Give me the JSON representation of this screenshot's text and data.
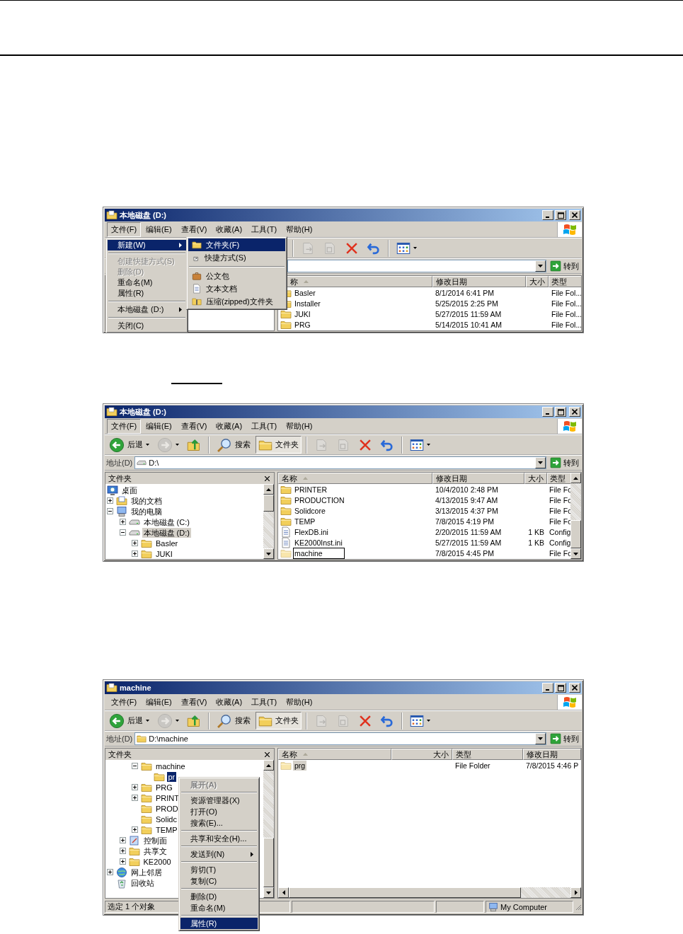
{
  "windows": [
    {
      "title": "本地磁盘 (D:)",
      "menu": [
        {
          "label": "文件(F)",
          "selected": true
        },
        {
          "label": "编辑(E)",
          "selected": false
        },
        {
          "label": "查看(V)",
          "selected": false
        },
        {
          "label": "收藏(A)",
          "selected": false
        },
        {
          "label": "工具(T)",
          "selected": false
        },
        {
          "label": "帮助(H)",
          "selected": false
        }
      ],
      "toolbar": [
        {
          "kind": "separator"
        },
        {
          "kind": "move",
          "disabled": true
        },
        {
          "kind": "copy",
          "disabled": true
        },
        {
          "kind": "delete",
          "disabled": false
        },
        {
          "kind": "undo",
          "disabled": false
        },
        {
          "kind": "separator"
        },
        {
          "kind": "views",
          "disabled": false
        }
      ],
      "address": {
        "go_label": "转到"
      },
      "file_list": {
        "columns": [
          {
            "kind": "name",
            "label": "称",
            "sorted": true
          },
          {
            "kind": "date",
            "label": "修改日期",
            "sorted": false
          },
          {
            "kind": "size",
            "label": "大小",
            "sorted": false
          },
          {
            "kind": "type",
            "label": "类型",
            "sorted": false
          }
        ],
        "rows": [
          {
            "kind": "folder",
            "name": "Basler",
            "date": "8/1/2014 6:41 PM",
            "type": "File Fol...",
            "selected": false,
            "editing": false
          },
          {
            "kind": "folder",
            "name": "Installer",
            "date": "5/25/2015 2:25 PM",
            "type": "File Fol...",
            "selected": false,
            "editing": false
          },
          {
            "kind": "folder",
            "name": "JUKI",
            "date": "5/27/2015 11:59 AM",
            "type": "File Fol...",
            "selected": false,
            "editing": false
          },
          {
            "kind": "folder",
            "name": "PRG",
            "date": "5/14/2015 10:41 AM",
            "type": "File Fol...",
            "selected": false,
            "editing": false
          }
        ]
      },
      "file_menu": [
        {
          "kind": "item",
          "label": "新建(W)",
          "selected": true,
          "disabled": false,
          "submenu": true
        },
        {
          "kind": "separator"
        },
        {
          "kind": "item",
          "label": "创建快捷方式(S)",
          "selected": false,
          "disabled": true,
          "submenu": false
        },
        {
          "kind": "item",
          "label": "删除(D)",
          "selected": false,
          "disabled": true,
          "submenu": false
        },
        {
          "kind": "item",
          "label": "重命名(M)",
          "selected": false,
          "disabled": false,
          "submenu": false
        },
        {
          "kind": "item",
          "label": "属性(R)",
          "selected": false,
          "disabled": false,
          "submenu": false
        },
        {
          "kind": "separator"
        },
        {
          "kind": "item",
          "label": "本地磁盘 (D:)",
          "selected": false,
          "disabled": false,
          "submenu": true
        },
        {
          "kind": "separator"
        },
        {
          "kind": "item",
          "label": "关闭(C)",
          "selected": false,
          "disabled": false,
          "submenu": false
        }
      ],
      "new_submenu": [
        {
          "kind": "folder",
          "label": "文件夹(F)",
          "selected": true
        },
        {
          "kind": "shortcut",
          "label": "快捷方式(S)",
          "selected": false
        },
        {
          "kind": "separator"
        },
        {
          "kind": "briefcase",
          "label": "公文包",
          "selected": false
        },
        {
          "kind": "textdoc",
          "label": "文本文档",
          "selected": false
        },
        {
          "kind": "zip",
          "label": "压缩(zipped)文件夹",
          "selected": false
        }
      ]
    },
    {
      "title": "本地磁盘 (D:)",
      "menu": [
        {
          "label": "文件(F)",
          "selected": true
        },
        {
          "label": "编辑(E)",
          "selected": false
        },
        {
          "label": "查看(V)",
          "selected": false
        },
        {
          "label": "收藏(A)",
          "selected": false
        },
        {
          "label": "工具(T)",
          "selected": false
        },
        {
          "label": "帮助(H)",
          "selected": false
        }
      ],
      "toolbar": [
        {
          "kind": "back",
          "label": "后退",
          "disabled": false
        },
        {
          "kind": "forward",
          "disabled": true
        },
        {
          "kind": "up",
          "disabled": false
        },
        {
          "kind": "separator"
        },
        {
          "kind": "search",
          "label": "搜索",
          "disabled": false,
          "pressed": false
        },
        {
          "kind": "folders",
          "label": "文件夹",
          "disabled": false,
          "pressed": true
        },
        {
          "kind": "separator"
        },
        {
          "kind": "move",
          "disabled": true
        },
        {
          "kind": "copy",
          "disabled": true
        },
        {
          "kind": "delete",
          "disabled": false
        },
        {
          "kind": "undo",
          "disabled": false
        },
        {
          "kind": "separator"
        },
        {
          "kind": "views",
          "disabled": false
        }
      ],
      "address": {
        "label": "地址(D)",
        "kind": "drive",
        "value": "D:\\",
        "go_label": "转到"
      },
      "folder_pane": {
        "title": "文件夹",
        "focused": false,
        "tree": [
          {
            "kind": "desktop",
            "label": "桌面",
            "selected": false,
            "children": [
              {
                "kind": "documents",
                "label": "我的文档",
                "expanded": false,
                "selected": false
              },
              {
                "kind": "computer",
                "label": "我的电脑",
                "expanded": true,
                "selected": false,
                "children": [
                  {
                    "kind": "drive",
                    "label": "本地磁盘 (C:)",
                    "expanded": false,
                    "selected": false
                  },
                  {
                    "kind": "drive",
                    "label": "本地磁盘 (D:)",
                    "expanded": true,
                    "selected": true,
                    "children": [
                      {
                        "kind": "folder",
                        "label": "Basler",
                        "expanded": false,
                        "selected": false
                      },
                      {
                        "kind": "folder",
                        "label": "JUKI",
                        "expanded": false,
                        "selected": false
                      }
                    ]
                  }
                ]
              }
            ]
          }
        ]
      },
      "file_list": {
        "columns": [
          {
            "kind": "name",
            "label": "名称",
            "sorted": true
          },
          {
            "kind": "date",
            "label": "修改日期",
            "sorted": false
          },
          {
            "kind": "size",
            "label": "大小",
            "sorted": false
          },
          {
            "kind": "type",
            "label": "类型",
            "sorted": false
          }
        ],
        "rows": [
          {
            "kind": "folder",
            "name": "PRINTER",
            "date": "10/4/2010 2:48 PM",
            "type": "File Fc",
            "selected": false,
            "editing": false
          },
          {
            "kind": "folder",
            "name": "PRODUCTION",
            "date": "4/13/2015 9:47 AM",
            "type": "File Fc",
            "selected": false,
            "editing": false
          },
          {
            "kind": "folder",
            "name": "Solidcore",
            "date": "3/13/2015 4:37 PM",
            "type": "File Fc",
            "selected": false,
            "editing": false
          },
          {
            "kind": "folder",
            "name": "TEMP",
            "date": "7/8/2015 4:19 PM",
            "type": "File Fc",
            "selected": false,
            "editing": false
          },
          {
            "kind": "ini",
            "name": "FlexDB.ini",
            "date": "2/20/2015 11:59 AM",
            "size": "1 KB",
            "type": "Config",
            "selected": false,
            "editing": false
          },
          {
            "kind": "ini",
            "name": "KE2000Inst.ini",
            "date": "5/27/2015 11:59 AM",
            "size": "1 KB",
            "type": "Config",
            "selected": false,
            "editing": false
          },
          {
            "kind": "folder",
            "name": "machine",
            "date": "7/8/2015 4:45 PM",
            "type": "File Fc",
            "selected": false,
            "editing": true
          }
        ]
      }
    },
    {
      "title": "machine",
      "menu": [
        {
          "label": "文件(F)",
          "selected": false
        },
        {
          "label": "编辑(E)",
          "selected": false
        },
        {
          "label": "查看(V)",
          "selected": false
        },
        {
          "label": "收藏(A)",
          "selected": false
        },
        {
          "label": "工具(T)",
          "selected": false
        },
        {
          "label": "帮助(H)",
          "selected": false
        }
      ],
      "toolbar": [
        {
          "kind": "back",
          "label": "后退",
          "disabled": false
        },
        {
          "kind": "forward",
          "disabled": true
        },
        {
          "kind": "up",
          "disabled": false
        },
        {
          "kind": "separator"
        },
        {
          "kind": "search",
          "label": "搜索",
          "disabled": false,
          "pressed": false
        },
        {
          "kind": "folders",
          "label": "文件夹",
          "disabled": false,
          "pressed": true
        },
        {
          "kind": "separator"
        },
        {
          "kind": "move",
          "disabled": true
        },
        {
          "kind": "copy",
          "disabled": true
        },
        {
          "kind": "delete",
          "disabled": false
        },
        {
          "kind": "undo",
          "disabled": false
        },
        {
          "kind": "separator"
        },
        {
          "kind": "views",
          "disabled": false
        }
      ],
      "address": {
        "label": "地址(D)",
        "kind": "folder",
        "value": "D:\\machine",
        "go_label": "转到"
      },
      "folder_pane": {
        "title": "文件夹",
        "focused": true,
        "tree": [
          {
            "children": [
              {
                "children": [
                  {
                    "children": [
                      {
                        "kind": "folder",
                        "label": "machine",
                        "expanded": true,
                        "selected": false,
                        "children": [
                          {
                            "kind": "folder",
                            "label": "pr",
                            "selected": true
                          }
                        ]
                      },
                      {
                        "kind": "folder",
                        "label": "PRG",
                        "expanded": false,
                        "selected": false
                      },
                      {
                        "kind": "folder",
                        "label": "PRINT",
                        "expanded": false,
                        "selected": false
                      },
                      {
                        "kind": "folder",
                        "label": "PROD",
                        "selected": false
                      },
                      {
                        "kind": "folder",
                        "label": "Solidc",
                        "selected": false
                      },
                      {
                        "kind": "folder",
                        "label": "TEMP",
                        "expanded": false,
                        "selected": false
                      }
                    ]
                  },
                  {
                    "kind": "controlpanel",
                    "label": "控制面",
                    "expanded": false,
                    "selected": false
                  },
                  {
                    "kind": "folder",
                    "label": "共享文",
                    "expanded": false,
                    "selected": false
                  },
                  {
                    "kind": "folder",
                    "label": "KE2000",
                    "expanded": false,
                    "selected": false
                  }
                ]
              },
              {
                "kind": "network",
                "label": "网上邻居",
                "expanded": false,
                "selected": false
              },
              {
                "kind": "recycle",
                "label": "回收站",
                "selected": false
              }
            ]
          }
        ]
      },
      "file_list": {
        "focused": false,
        "columns": [
          {
            "kind": "name",
            "label": "名称",
            "sorted": true
          },
          {
            "kind": "size",
            "label": "大小",
            "sorted": false
          },
          {
            "kind": "type",
            "label": "类型",
            "sorted": false
          },
          {
            "kind": "date",
            "label": "修改日期",
            "sorted": false
          }
        ],
        "rows": [
          {
            "kind": "folder",
            "name": "prg",
            "type": "File Folder",
            "date": "7/8/2015 4:46 P",
            "selected": true,
            "editing": false
          }
        ]
      },
      "context_menu": [
        {
          "kind": "item",
          "label": "展开(A)",
          "selected": false,
          "disabled": true,
          "default": true,
          "submenu": false
        },
        {
          "kind": "separator"
        },
        {
          "kind": "item",
          "label": "资源管理器(X)",
          "selected": false,
          "disabled": false,
          "default": false,
          "submenu": false
        },
        {
          "kind": "item",
          "label": "打开(O)",
          "selected": false,
          "disabled": false,
          "default": false,
          "submenu": false
        },
        {
          "kind": "item",
          "label": "搜索(E)...",
          "selected": false,
          "disabled": false,
          "default": false,
          "submenu": false
        },
        {
          "kind": "separator"
        },
        {
          "kind": "item",
          "label": "共享和安全(H)...",
          "selected": false,
          "disabled": false,
          "default": false,
          "submenu": false
        },
        {
          "kind": "separator"
        },
        {
          "kind": "item",
          "label": "发送到(N)",
          "selected": false,
          "disabled": false,
          "default": false,
          "submenu": true
        },
        {
          "kind": "separator"
        },
        {
          "kind": "item",
          "label": "剪切(T)",
          "selected": false,
          "disabled": false,
          "default": false,
          "submenu": false
        },
        {
          "kind": "item",
          "label": "复制(C)",
          "selected": false,
          "disabled": false,
          "default": false,
          "submenu": false
        },
        {
          "kind": "separator"
        },
        {
          "kind": "item",
          "label": "删除(D)",
          "selected": false,
          "disabled": false,
          "default": false,
          "submenu": false
        },
        {
          "kind": "item",
          "label": "重命名(M)",
          "selected": false,
          "disabled": false,
          "default": false,
          "submenu": false
        },
        {
          "kind": "separator"
        },
        {
          "kind": "item",
          "label": "属性(R)",
          "selected": true,
          "disabled": false,
          "default": false,
          "submenu": false
        }
      ],
      "status_bar": {
        "text": "选定 1 个对象",
        "zone": "My Computer"
      }
    }
  ]
}
